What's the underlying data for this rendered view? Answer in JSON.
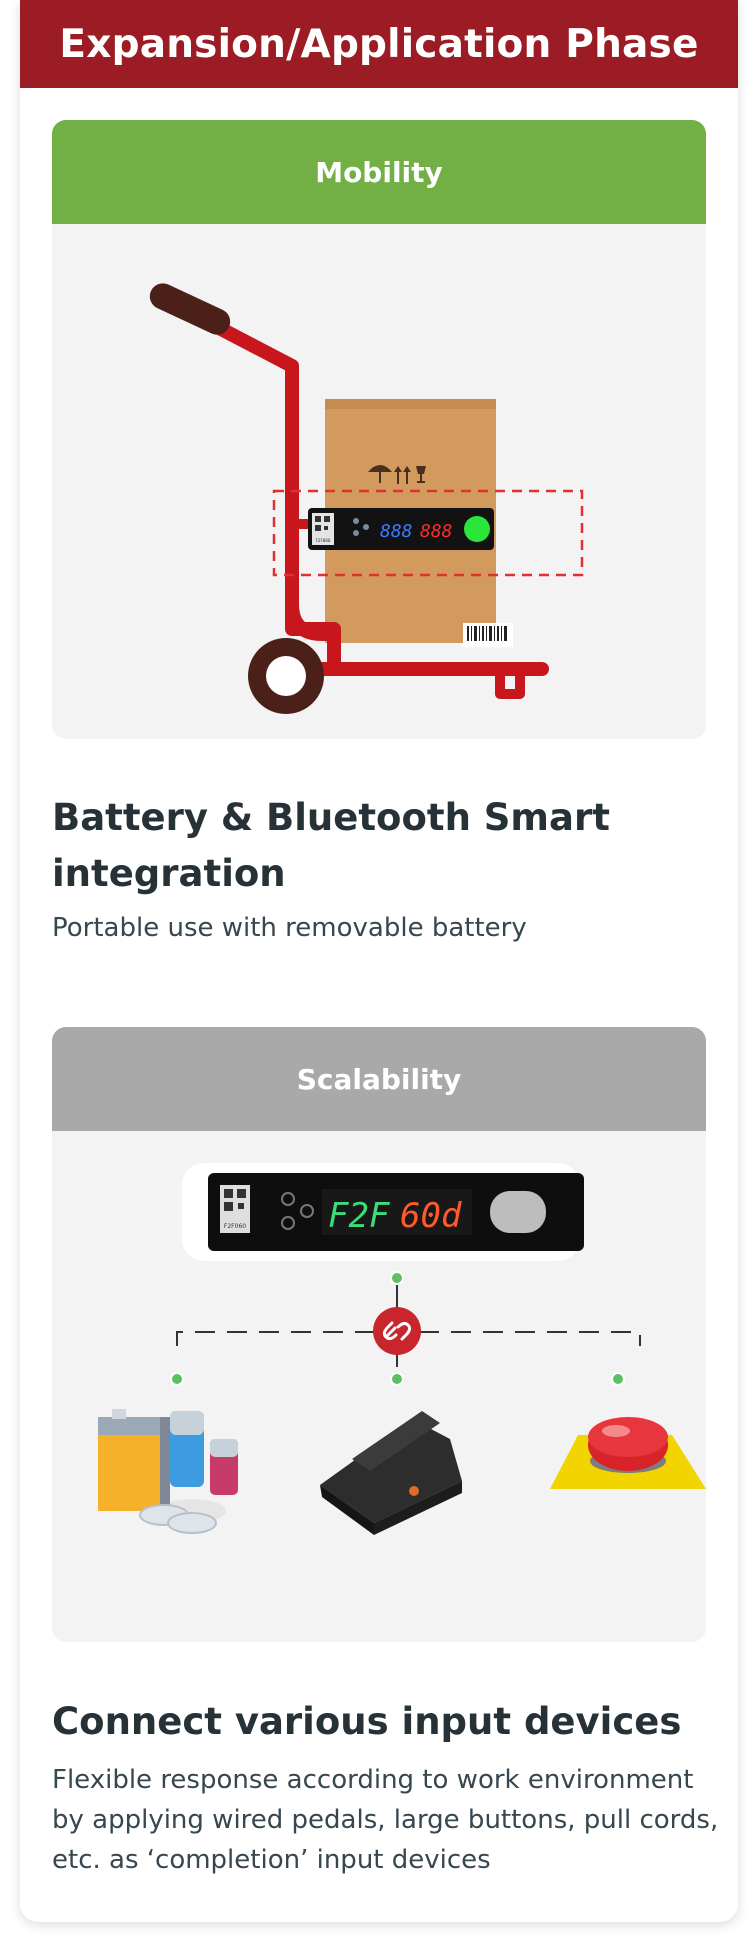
{
  "header": {
    "title": "Expansion/Application Phase"
  },
  "mobility": {
    "tab_label": "Mobility",
    "title": "Battery & Bluetooth Smart integration",
    "description": "Portable use with removable battery",
    "device_display": {
      "left_digits": "888",
      "right_digits": "888"
    },
    "qr_label": "F2F888"
  },
  "scalability": {
    "tab_label": "Scalability",
    "title": "Connect various input devices",
    "description": "Flexible response according to work environment by applying wired pedals, large buttons, pull cords, etc. as ‘completion’ input devices",
    "device_display": {
      "left_text": "F2F",
      "right_text": "60d"
    },
    "qr_label": "F2F060"
  },
  "colors": {
    "header_red": "#9b1c24",
    "mobility_green": "#72b046",
    "scalability_gray": "#a9a9a9",
    "cart_red": "#c8161d",
    "box_brown": "#d29b5d"
  }
}
